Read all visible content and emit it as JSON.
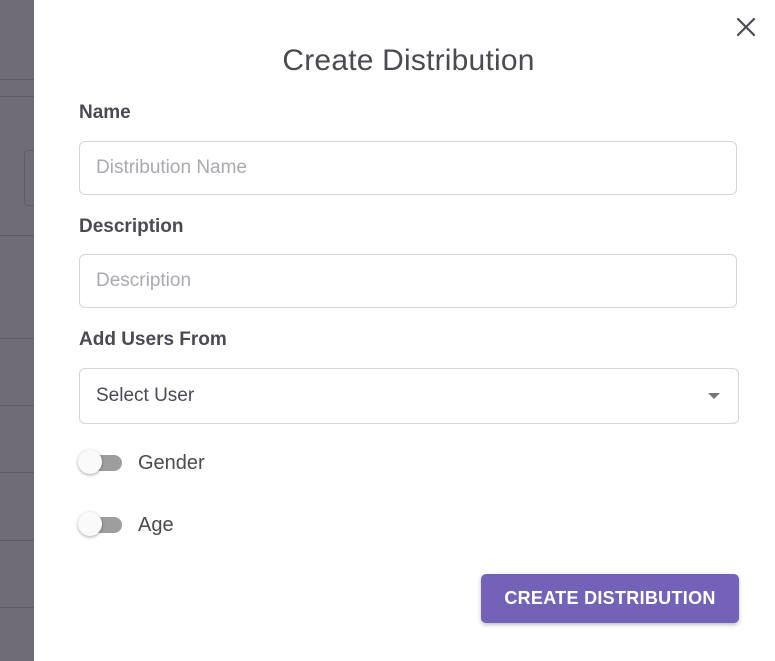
{
  "drawer": {
    "title": "Create Distribution",
    "close_icon": "close-icon"
  },
  "form": {
    "name": {
      "label": "Name",
      "value": "",
      "placeholder": "Distribution Name"
    },
    "description": {
      "label": "Description",
      "value": "",
      "placeholder": "Description"
    },
    "add_users_from": {
      "label": "Add Users From",
      "selected": "Select User",
      "icon": "chevron-down-icon"
    },
    "toggles": [
      {
        "label": "Gender",
        "checked": false
      },
      {
        "label": "Age",
        "checked": false
      }
    ],
    "submit_label": "CREATE DISTRIBUTION"
  },
  "colors": {
    "primary": "#7462b8",
    "text": "#4a4a55",
    "border": "#d5d5da",
    "placeholder": "#a9a9b0",
    "backdrop": "#6f6c76"
  }
}
